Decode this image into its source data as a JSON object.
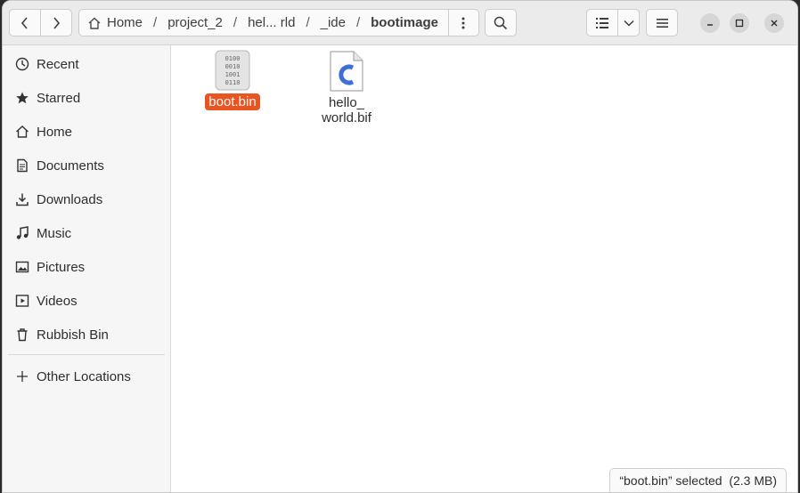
{
  "breadcrumbs": [
    "Home",
    "project_2",
    "hel... rld",
    "_ide",
    "bootimage"
  ],
  "sidebar": {
    "items": [
      {
        "label": "Recent",
        "icon": "clock-icon"
      },
      {
        "label": "Starred",
        "icon": "star-icon"
      },
      {
        "label": "Home",
        "icon": "home-icon"
      },
      {
        "label": "Documents",
        "icon": "document-icon"
      },
      {
        "label": "Downloads",
        "icon": "download-icon"
      },
      {
        "label": "Music",
        "icon": "music-icon"
      },
      {
        "label": "Pictures",
        "icon": "picture-icon"
      },
      {
        "label": "Videos",
        "icon": "video-icon"
      },
      {
        "label": "Rubbish Bin",
        "icon": "trash-icon"
      }
    ],
    "other_locations": {
      "label": "Other Locations",
      "icon": "plus-icon"
    }
  },
  "files": [
    {
      "name": "boot.bin",
      "icon": "binary-file-icon",
      "selected": true
    },
    {
      "name": "hello_\nworld.bif",
      "icon": "c-source-file-icon",
      "selected": false
    }
  ],
  "binary_icon_text": [
    "0100",
    "0010",
    "1001",
    "0110"
  ],
  "status_text": "“boot.bin” selected  (2.3 MB)",
  "colors": {
    "selection": "#e95420",
    "c_icon": "#3f6fd6"
  }
}
